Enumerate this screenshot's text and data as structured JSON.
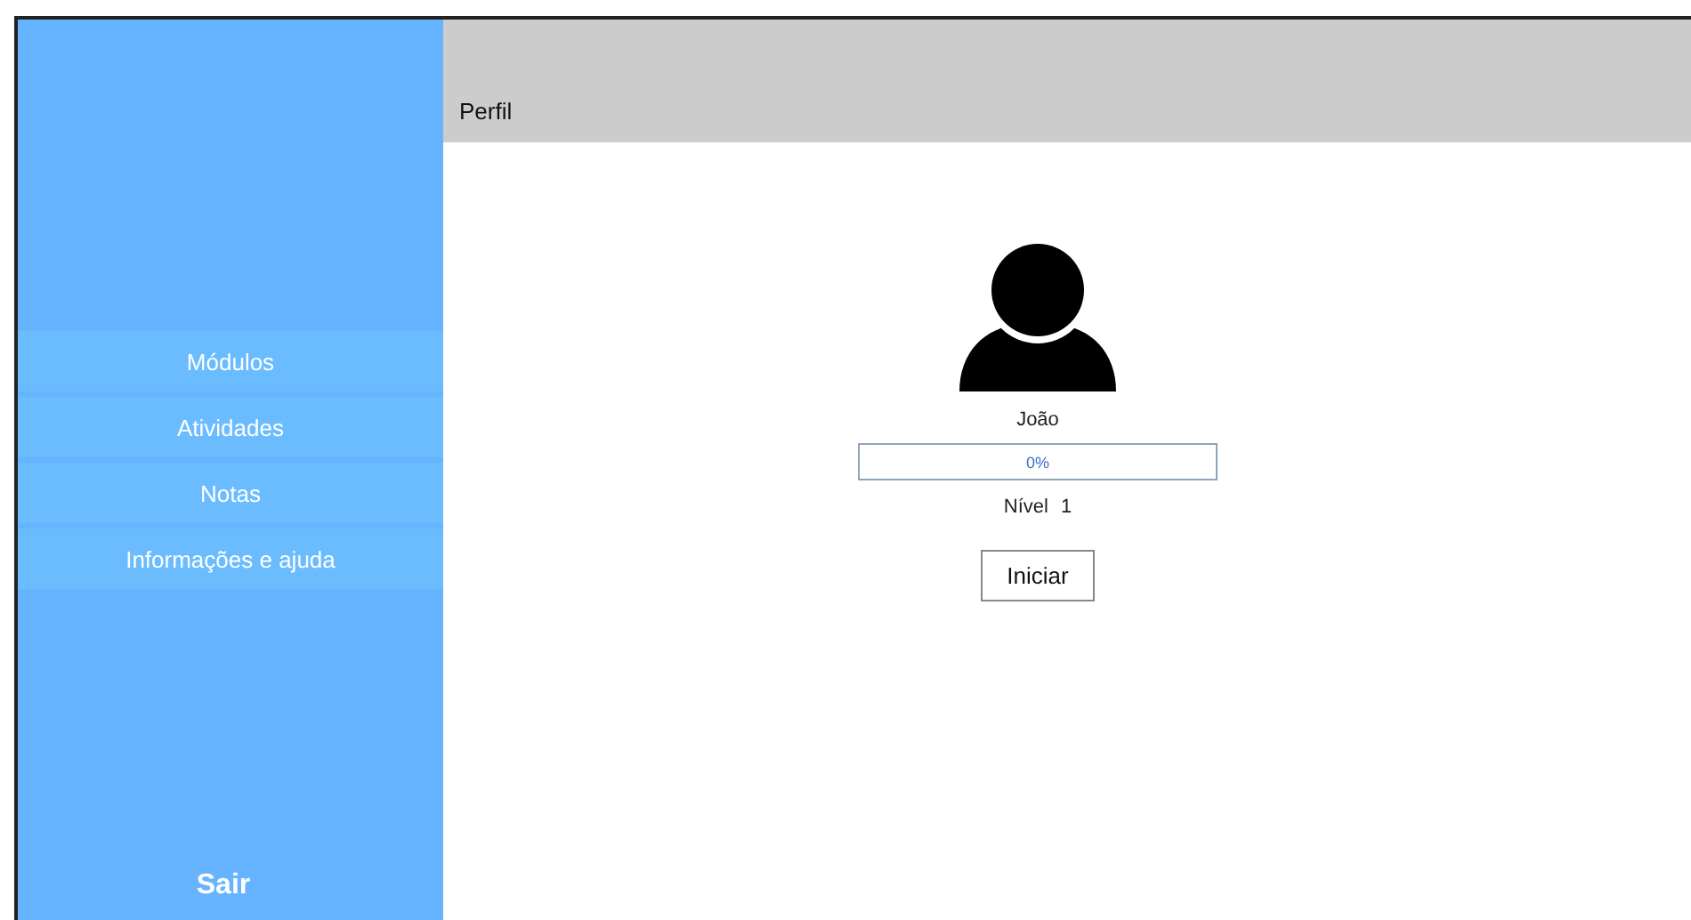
{
  "sidebar": {
    "items": [
      {
        "label": "Módulos"
      },
      {
        "label": "Atividades"
      },
      {
        "label": "Notas"
      },
      {
        "label": "Informações e ajuda"
      }
    ],
    "logout": "Sair"
  },
  "header": {
    "title": "Perfil"
  },
  "profile": {
    "name": "João",
    "progress": {
      "level": 0,
      "reading": "0%"
    },
    "level_label": "Nível",
    "level_value": "1",
    "start_button": "Iniciar"
  }
}
